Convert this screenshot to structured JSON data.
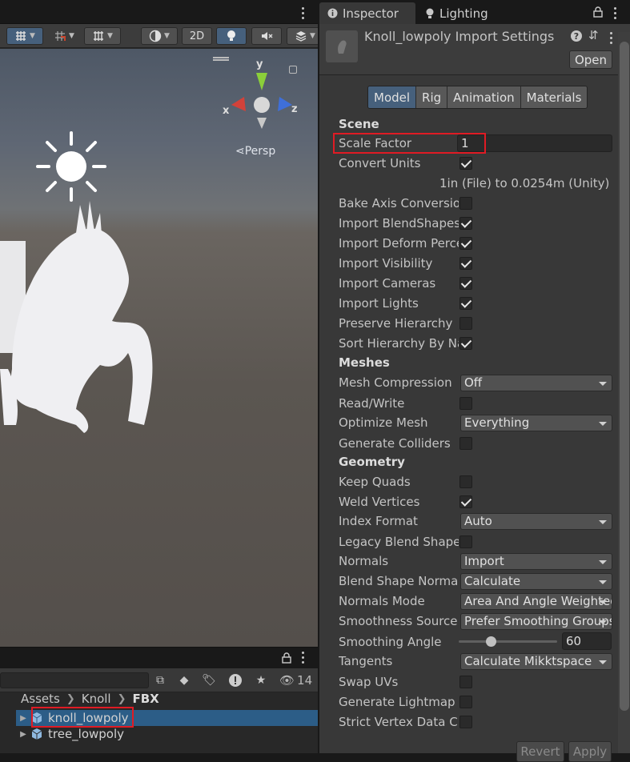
{
  "inspector": {
    "tabs": [
      {
        "label": "Inspector",
        "icon": "info-icon"
      },
      {
        "label": "Lighting",
        "icon": "bulb-icon"
      }
    ],
    "asset_title": "Knoll_lowpoly Import Settings",
    "open_label": "Open",
    "importer_tabs": [
      "Model",
      "Rig",
      "Animation",
      "Materials"
    ],
    "active_importer_tab": "Model",
    "scene_section": "Scene",
    "scale_factor_label": "Scale Factor",
    "scale_factor_value": "1",
    "convert_units_label": "Convert Units",
    "convert_units_note": "1in (File) to 0.0254m (Unity)",
    "scene_toggles": [
      {
        "label": "Bake Axis Conversion",
        "checked": false
      },
      {
        "label": "Import BlendShapes",
        "checked": true
      },
      {
        "label": "Import Deform Percent",
        "checked": true
      },
      {
        "label": "Import Visibility",
        "checked": true
      },
      {
        "label": "Import Cameras",
        "checked": true
      },
      {
        "label": "Import Lights",
        "checked": true
      },
      {
        "label": "Preserve Hierarchy",
        "checked": false
      },
      {
        "label": "Sort Hierarchy By Name",
        "checked": true
      }
    ],
    "meshes_section": "Meshes",
    "mesh_compression_label": "Mesh Compression",
    "mesh_compression_value": "Off",
    "read_write_label": "Read/Write",
    "optimize_mesh_label": "Optimize Mesh",
    "optimize_mesh_value": "Everything",
    "generate_colliders_label": "Generate Colliders",
    "geometry_section": "Geometry",
    "keep_quads_label": "Keep Quads",
    "weld_vertices_label": "Weld Vertices",
    "index_format_label": "Index Format",
    "index_format_value": "Auto",
    "legacy_blend_label": "Legacy Blend Shape Normals",
    "normals_label": "Normals",
    "normals_value": "Import",
    "blend_shape_normals_label": "Blend Shape Normals",
    "blend_shape_normals_value": "Calculate",
    "normals_mode_label": "Normals Mode",
    "normals_mode_value": "Area And Angle Weighted",
    "smoothness_source_label": "Smoothness Source",
    "smoothness_source_value": "Prefer Smoothing Groups",
    "smoothing_angle_label": "Smoothing Angle",
    "smoothing_angle_value": "60",
    "smoothing_angle_fraction": 0.33,
    "tangents_label": "Tangents",
    "tangents_value": "Calculate Mikktspace",
    "swap_uvs_label": "Swap UVs",
    "generate_lightmap_label": "Generate Lightmap UVs",
    "strict_vertex_label": "Strict Vertex Data Checks",
    "revert_label": "Revert",
    "apply_label": "Apply"
  },
  "scene": {
    "toolbar_2d_label": "2D",
    "gizmo_y": "y",
    "gizmo_x": "x",
    "gizmo_z": "z",
    "persp_label": "Persp"
  },
  "project": {
    "hidden_count": "14",
    "breadcrumb": [
      "Assets",
      "Knoll",
      "FBX"
    ],
    "items": [
      {
        "label": "knoll_lowpoly",
        "selected": true
      },
      {
        "label": "tree_lowpoly",
        "selected": false
      }
    ]
  },
  "colors": {
    "selection": "#2c5d87",
    "active_tab": "#46607c",
    "highlight": "#e01b24"
  }
}
